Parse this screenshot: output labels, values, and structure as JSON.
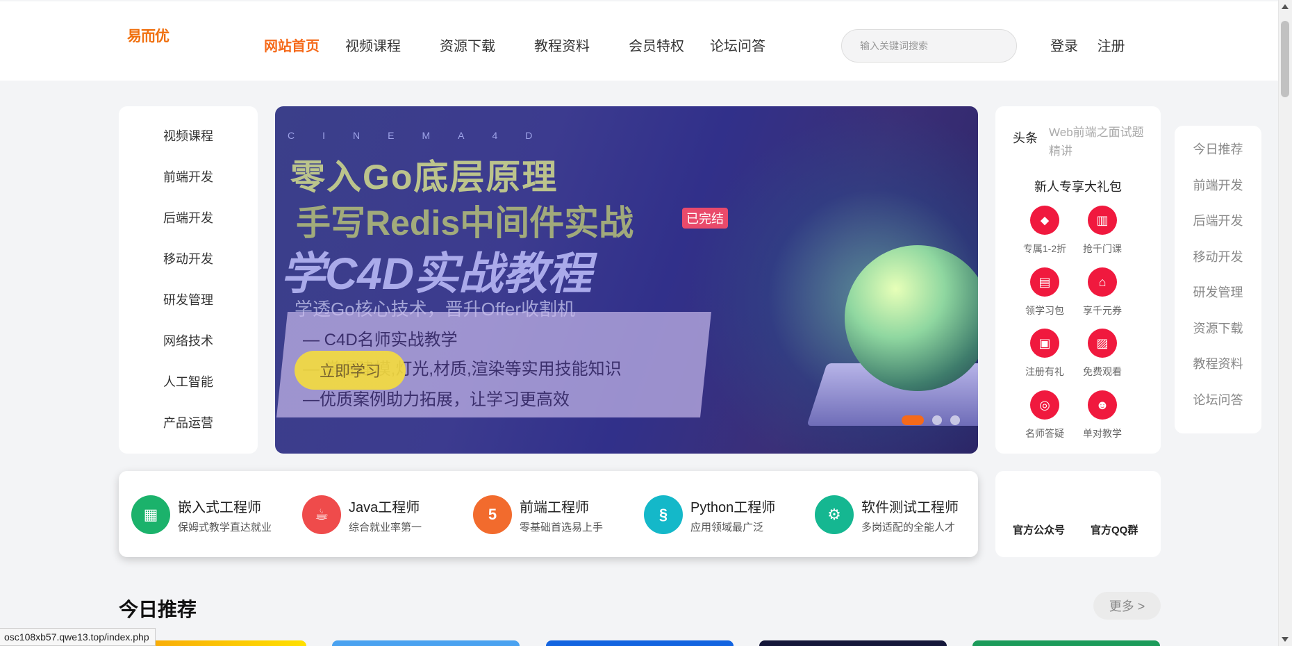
{
  "header": {
    "logo": "易而优",
    "nav": [
      "网站首页",
      "视频课程",
      "资源下载",
      "教程资料",
      "会员特权",
      "论坛问答"
    ],
    "search_placeholder": "输入关键词搜索",
    "login": "登录",
    "register": "注册"
  },
  "categories": [
    "视频课程",
    "前端开发",
    "后端开发",
    "移动开发",
    "研发管理",
    "网络技术",
    "人工智能",
    "产品运营"
  ],
  "banner": {
    "cinema": "CINEMA4D",
    "title1": "零入Go底层原理",
    "title2": "手写Redis中间件实战",
    "title3": "学C4D实战教程",
    "subtitle": "学透Go核心技术，晋升Offer收割机",
    "lines": [
      "— C4D名师实战教学",
      "— 掌握建模,灯光,材质,渲染等实用技能知识",
      "—优质案例助力拓展，让学习更高效"
    ],
    "button": "立即学习",
    "badge": "已完结",
    "active_slide": 1,
    "slide_count": 3
  },
  "gift_panel": {
    "headline_tag": "头条",
    "headline_text": "Web前端之面试题精讲",
    "title": "新人专享大礼包",
    "items": [
      {
        "label": "专属1-2折",
        "icon": "tag-icon"
      },
      {
        "label": "抢千门课",
        "icon": "chart-icon"
      },
      {
        "label": "领学习包",
        "icon": "book-icon"
      },
      {
        "label": "享千元券",
        "icon": "bank-icon"
      },
      {
        "label": "注册有礼",
        "icon": "calendar-icon"
      },
      {
        "label": "免费观看",
        "icon": "image-icon"
      },
      {
        "label": "名师答疑",
        "icon": "target-icon"
      },
      {
        "label": "单对教学",
        "icon": "robot-icon"
      }
    ],
    "icon_color": "#f0193e"
  },
  "side_menu": [
    "今日推荐",
    "前端开发",
    "后端开发",
    "移动开发",
    "研发管理",
    "资源下载",
    "教程资料",
    "论坛问答"
  ],
  "careers": [
    {
      "name": "嵌入式工程师",
      "desc": "保姆式教学直达就业",
      "color": "#1bb26b",
      "icon": "circuit-icon"
    },
    {
      "name": "Java工程师",
      "desc": "综合就业率第一",
      "color": "#ef4b4b",
      "icon": "java-icon"
    },
    {
      "name": "前端工程师",
      "desc": "零基础首选易上手",
      "color": "#f26b2d",
      "icon": "html5-icon"
    },
    {
      "name": "Python工程师",
      "desc": "应用领域最广泛",
      "color": "#14b8c9",
      "icon": "python-icon"
    },
    {
      "name": "软件测试工程师",
      "desc": "多岗适配的全能人才",
      "color": "#15b791",
      "icon": "test-icon"
    }
  ],
  "official": {
    "wechat": "官方公众号",
    "qq": "官方QQ群"
  },
  "today": {
    "title": "今日推荐",
    "more": "更多 >"
  },
  "status_url": "osc108xb57.qwe13.top/index.php",
  "accent": "#f56a1a"
}
